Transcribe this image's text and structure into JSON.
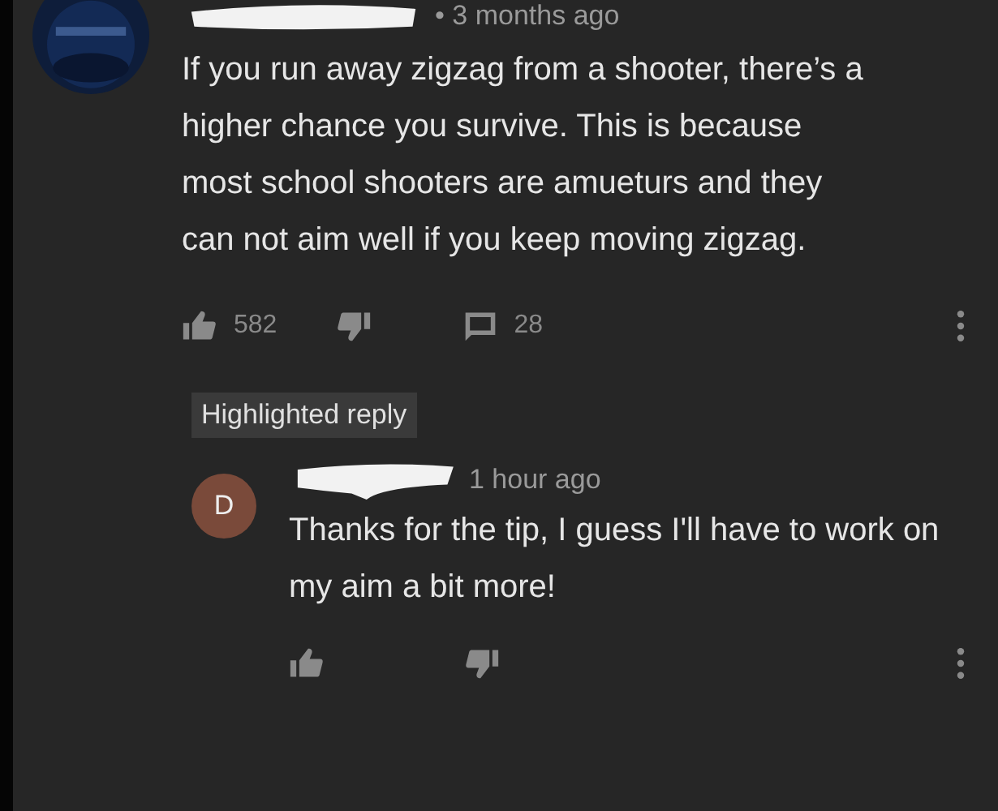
{
  "comments": [
    {
      "time": "• 3 months ago",
      "text": "If you run away zigzag from a shooter, there’s a higher chance you survive. This is because most school shooters are amueturs and they can not aim well if you keep moving zigzag.",
      "likes": "582",
      "replies": "28"
    }
  ],
  "reply": {
    "badge": "Highlighted reply",
    "avatar_letter": "D",
    "time": "1 hour ago",
    "text": "Thanks for the tip, I guess I'll have to work on my aim a bit more!"
  }
}
